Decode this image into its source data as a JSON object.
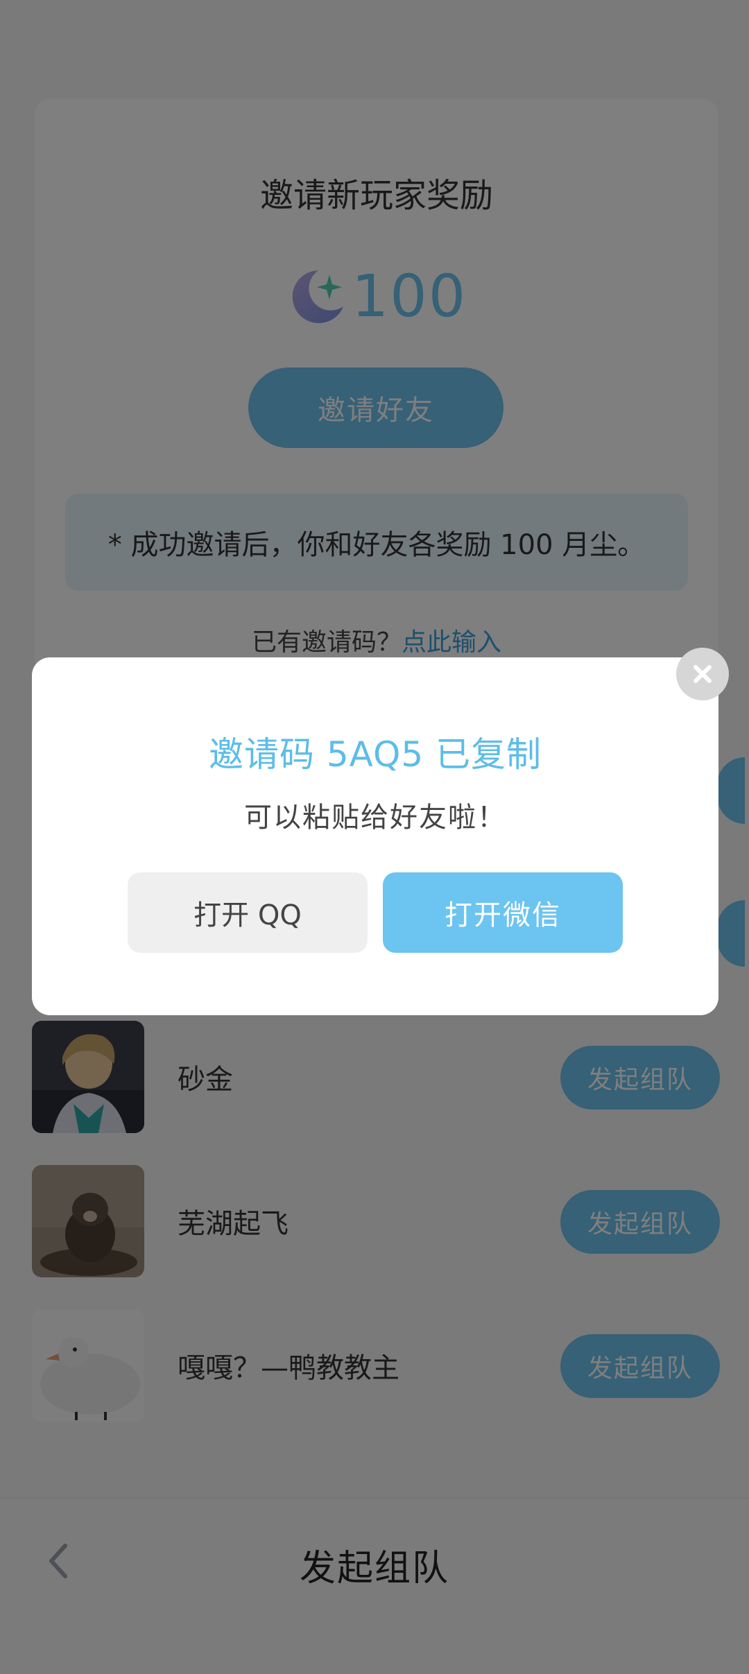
{
  "invite_card": {
    "title": "邀请新玩家奖励",
    "reward_amount": "100",
    "invite_button": "邀请好友",
    "notice": "* 成功邀请后，你和好友各奖励 100 月尘。",
    "have_code_text": "已有邀请码？",
    "enter_code_link": "点此输入"
  },
  "friends": [
    {
      "name": "砂金",
      "action": "发起组队"
    },
    {
      "name": "芜湖起飞",
      "action": "发起组队"
    },
    {
      "name": "嘎嘎？—鸭教教主",
      "action": "发起组队"
    }
  ],
  "bottom_bar": {
    "title": "发起组队"
  },
  "dialog": {
    "title": "邀请码 5AQ5 已复制",
    "subtitle": "可以粘贴给好友啦！",
    "qq_button": "打开 QQ",
    "wechat_button": "打开微信"
  },
  "colors": {
    "accent": "#6dc3ec",
    "link": "#3aa1d6",
    "overlay": "rgba(0,0,0,0.5)"
  }
}
